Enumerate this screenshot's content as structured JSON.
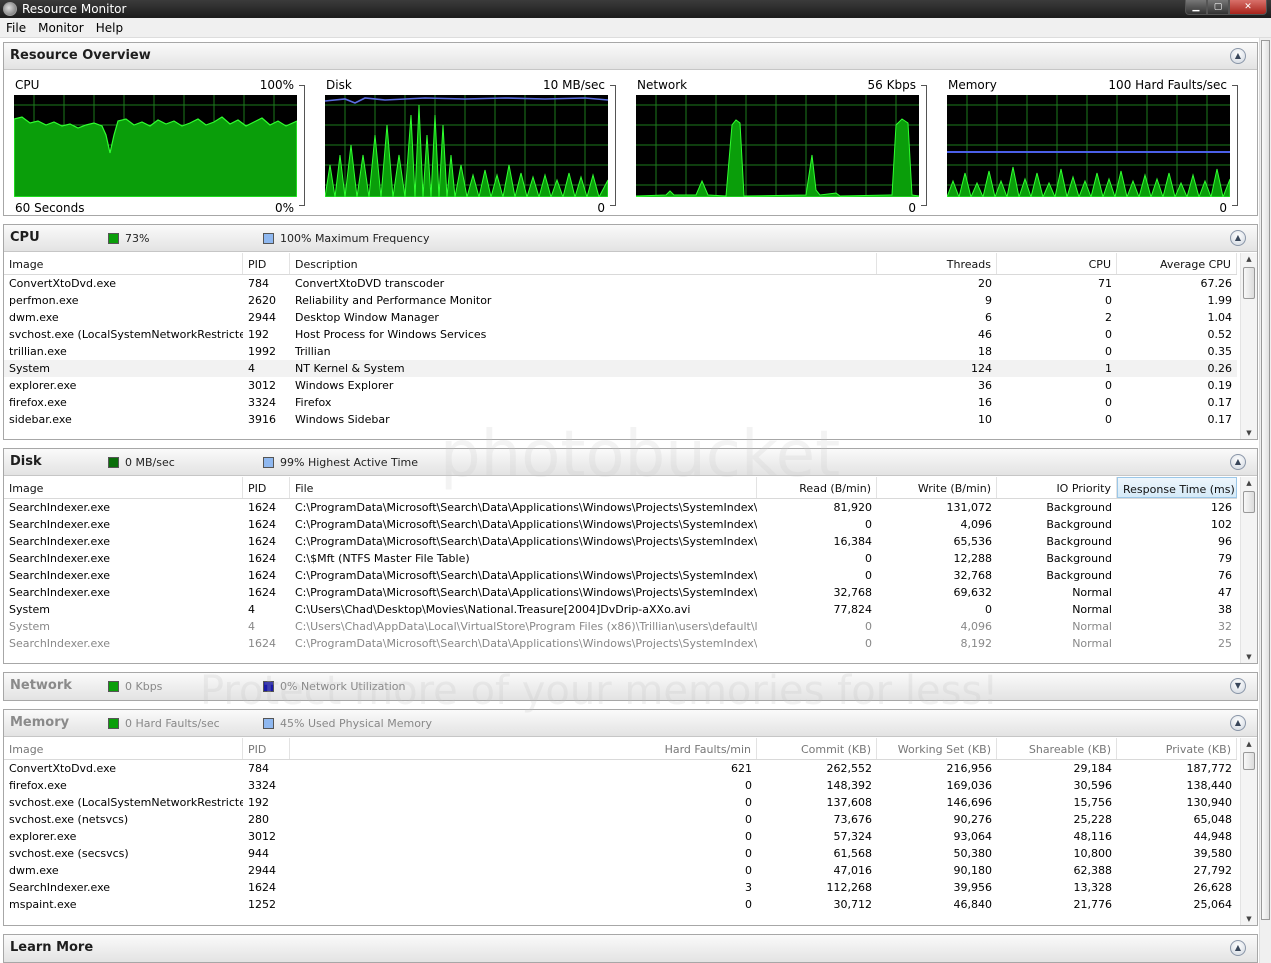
{
  "window": {
    "title": "Resource Monitor",
    "btn_min": "▁",
    "btn_max": "▢",
    "btn_close": "✕"
  },
  "menu": [
    "File",
    "Monitor",
    "Help"
  ],
  "overview": {
    "title": "Resource Overview",
    "graphs": [
      {
        "name": "CPU",
        "top_right": "100%",
        "bottom_left": "60 Seconds",
        "bottom_right": "0%"
      },
      {
        "name": "Disk",
        "top_right": "10 MB/sec",
        "bottom_left": "",
        "bottom_right": "0"
      },
      {
        "name": "Network",
        "top_right": "56 Kbps",
        "bottom_left": "",
        "bottom_right": "0"
      },
      {
        "name": "Memory",
        "top_right": "100 Hard Faults/sec",
        "bottom_left": "",
        "bottom_right": "0"
      }
    ]
  },
  "cpu": {
    "title": "CPU",
    "stat1": "73%",
    "stat2": "100% Maximum Frequency",
    "columns": [
      "Image",
      "PID",
      "Description",
      "Threads",
      "CPU",
      "Average CPU"
    ],
    "rows": [
      [
        "ConvertXtoDvd.exe",
        "784",
        "ConvertXtoDVD transcoder",
        "20",
        "71",
        "67.26"
      ],
      [
        "perfmon.exe",
        "2620",
        "Reliability and Performance Monitor",
        "9",
        "0",
        "1.99"
      ],
      [
        "dwm.exe",
        "2944",
        "Desktop Window Manager",
        "6",
        "2",
        "1.04"
      ],
      [
        "svchost.exe (LocalSystemNetworkRestricted)",
        "192",
        "Host Process for Windows Services",
        "46",
        "0",
        "0.52"
      ],
      [
        "trillian.exe",
        "1992",
        "Trillian",
        "18",
        "0",
        "0.35"
      ],
      [
        "System",
        "4",
        "NT Kernel & System",
        "124",
        "1",
        "0.26"
      ],
      [
        "explorer.exe",
        "3012",
        "Windows Explorer",
        "36",
        "0",
        "0.19"
      ],
      [
        "firefox.exe",
        "3324",
        "Firefox",
        "16",
        "0",
        "0.17"
      ],
      [
        "sidebar.exe",
        "3916",
        "Windows Sidebar",
        "10",
        "0",
        "0.17"
      ]
    ]
  },
  "disk": {
    "title": "Disk",
    "stat1": "0 MB/sec",
    "stat2": "99% Highest Active Time",
    "columns": [
      "Image",
      "PID",
      "File",
      "Read (B/min)",
      "Write (B/min)",
      "IO Priority",
      "Response Time (ms)"
    ],
    "rows": [
      [
        "SearchIndexer.exe",
        "1624",
        "C:\\ProgramData\\Microsoft\\Search\\Data\\Applications\\Windows\\Projects\\SystemIndex\\In...",
        "81,920",
        "131,072",
        "Background",
        "126"
      ],
      [
        "SearchIndexer.exe",
        "1624",
        "C:\\ProgramData\\Microsoft\\Search\\Data\\Applications\\Windows\\Projects\\SystemIndex\\In...",
        "0",
        "4,096",
        "Background",
        "102"
      ],
      [
        "SearchIndexer.exe",
        "1624",
        "C:\\ProgramData\\Microsoft\\Search\\Data\\Applications\\Windows\\Projects\\SystemIndex\\In...",
        "16,384",
        "65,536",
        "Background",
        "96"
      ],
      [
        "SearchIndexer.exe",
        "1624",
        "C:\\$Mft (NTFS Master File Table)",
        "0",
        "12,288",
        "Background",
        "79"
      ],
      [
        "SearchIndexer.exe",
        "1624",
        "C:\\ProgramData\\Microsoft\\Search\\Data\\Applications\\Windows\\Projects\\SystemIndex\\In...",
        "0",
        "32,768",
        "Background",
        "76"
      ],
      [
        "SearchIndexer.exe",
        "1624",
        "C:\\ProgramData\\Microsoft\\Search\\Data\\Applications\\Windows\\Projects\\SystemIndex\\In...",
        "32,768",
        "69,632",
        "Normal",
        "47"
      ],
      [
        "System",
        "4",
        "C:\\Users\\Chad\\Desktop\\Movies\\National.Treasure[2004]DvDrip-aXXo.avi",
        "77,824",
        "0",
        "Normal",
        "38"
      ],
      [
        "System",
        "4",
        "C:\\Users\\Chad\\AppData\\Local\\VirtualStore\\Program Files (x86)\\Trillian\\users\\default\\log...",
        "0",
        "4,096",
        "Normal",
        "32"
      ],
      [
        "SearchIndexer.exe",
        "1624",
        "C:\\ProgramData\\Microsoft\\Search\\Data\\Applications\\Windows\\Projects\\SystemIndex\\Sy...",
        "0",
        "8,192",
        "Normal",
        "25"
      ]
    ]
  },
  "network": {
    "title": "Network",
    "stat1": "0 Kbps",
    "stat2": "0% Network Utilization"
  },
  "memory": {
    "title": "Memory",
    "stat1": "0 Hard Faults/sec",
    "stat2": "45% Used Physical Memory",
    "columns": [
      "Image",
      "PID",
      "Hard Faults/min",
      "Commit (KB)",
      "Working Set (KB)",
      "Shareable (KB)",
      "Private (KB)"
    ],
    "rows": [
      [
        "ConvertXtoDvd.exe",
        "784",
        "621",
        "262,552",
        "216,956",
        "29,184",
        "187,772"
      ],
      [
        "firefox.exe",
        "3324",
        "0",
        "148,392",
        "169,036",
        "30,596",
        "138,440"
      ],
      [
        "svchost.exe (LocalSystemNetworkRestricted)",
        "192",
        "0",
        "137,608",
        "146,696",
        "15,756",
        "130,940"
      ],
      [
        "svchost.exe (netsvcs)",
        "280",
        "0",
        "73,676",
        "90,276",
        "25,228",
        "65,048"
      ],
      [
        "explorer.exe",
        "3012",
        "0",
        "57,324",
        "93,064",
        "48,116",
        "44,948"
      ],
      [
        "svchost.exe (secsvcs)",
        "944",
        "0",
        "61,568",
        "50,380",
        "10,800",
        "39,580"
      ],
      [
        "dwm.exe",
        "2944",
        "0",
        "47,016",
        "90,180",
        "62,388",
        "27,792"
      ],
      [
        "SearchIndexer.exe",
        "1624",
        "3",
        "112,268",
        "39,956",
        "13,328",
        "26,628"
      ],
      [
        "mspaint.exe",
        "1252",
        "0",
        "30,712",
        "46,840",
        "21,776",
        "25,064"
      ]
    ]
  },
  "learn_more": {
    "title": "Learn More"
  },
  "watermark": {
    "line1": "photobucket",
    "line2": "Protect more of your memories for less!"
  },
  "colors": {
    "graph_bg": "#000000",
    "graph_grid": "#1d7a1d",
    "graph_line": "#2fff2f",
    "graph_fill": "#0a9e0a",
    "disk_line": "#5b6ee0",
    "mem_line": "#4b5fe8"
  }
}
